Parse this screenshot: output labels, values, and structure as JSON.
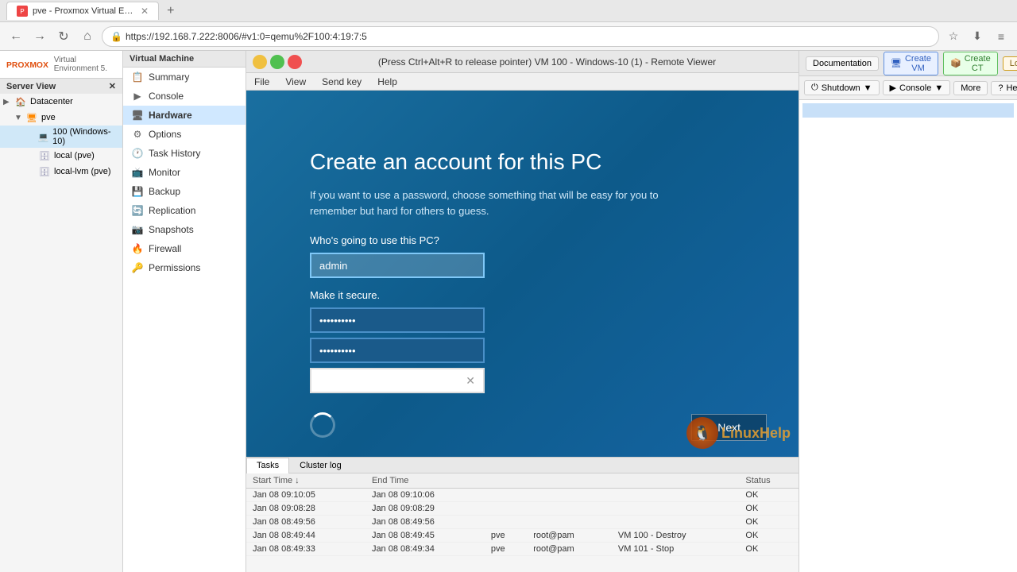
{
  "browser": {
    "tab_title": "pve - Proxmox Virtual Environ...",
    "url": "https://192.168.7.222:8006/#v1:0=qemu%2F100:4:19:7:5",
    "new_tab_label": "+"
  },
  "remote_viewer": {
    "title": "(Press Ctrl+Alt+R to release pointer) VM 100 - Windows-10 (1) - Remote Viewer",
    "menu_items": [
      "File",
      "View",
      "Send key",
      "Help"
    ]
  },
  "proxmox": {
    "logo_text": "PROXMOX",
    "subtitle": "Virtual Environment 5.",
    "server_view": "Server View",
    "tree": {
      "datacenter": "Datacenter",
      "server": "pve",
      "vm": "100 (Windows-10)",
      "storage1": "local (pve)",
      "storage2": "local-lvm (pve)"
    },
    "vm_menu": {
      "header": "Virtual Machine",
      "items": [
        {
          "id": "summary",
          "label": "Summary",
          "icon": "📋"
        },
        {
          "id": "console",
          "label": "Console",
          "icon": "▶"
        },
        {
          "id": "hardware",
          "label": "Hardware",
          "icon": "🖥"
        },
        {
          "id": "options",
          "label": "Options",
          "icon": "⚙"
        },
        {
          "id": "task-history",
          "label": "Task History",
          "icon": "🕐"
        },
        {
          "id": "monitor",
          "label": "Monitor",
          "icon": "📺"
        },
        {
          "id": "backup",
          "label": "Backup",
          "icon": "💾"
        },
        {
          "id": "replication",
          "label": "Replication",
          "icon": "🔄"
        },
        {
          "id": "snapshots",
          "label": "Snapshots",
          "icon": "📷"
        },
        {
          "id": "firewall",
          "label": "Firewall",
          "icon": "🔥"
        },
        {
          "id": "permissions",
          "label": "Permissions",
          "icon": "🔑"
        }
      ]
    },
    "header_buttons": {
      "documentation": "Documentation",
      "create_vm": "Create VM",
      "create_ct": "Create CT",
      "logout": "Logout"
    },
    "toolbar": {
      "shutdown": "Shutdown",
      "console": "Console",
      "more": "More",
      "help": "Help"
    }
  },
  "windows_setup": {
    "title": "Create an account for this PC",
    "description": "If you want to use a password, choose something that will be easy for you to remember but hard for others to guess.",
    "username_label": "Who's going to use this PC?",
    "username_value": "admin",
    "password_section_label": "Make it secure.",
    "password_dots": "••••••••••",
    "confirm_password_dots": "••••••••••",
    "hint_value": "",
    "next_button": "Next"
  },
  "tasks": {
    "tabs": [
      "Tasks",
      "Cluster log"
    ],
    "active_tab": "Tasks",
    "columns": [
      "Start Time",
      "End Time",
      "",
      "",
      "",
      "Status"
    ],
    "rows": [
      {
        "start": "Jan 08 09:10:05",
        "end": "Jan 08 09:10:06",
        "col3": "",
        "col4": "",
        "col5": "",
        "status": "OK"
      },
      {
        "start": "Jan 08 09:08:28",
        "end": "Jan 08 09:08:29",
        "col3": "",
        "col4": "",
        "col5": "",
        "status": "OK"
      },
      {
        "start": "Jan 08 08:49:56",
        "end": "Jan 08 08:49:56",
        "col3": "",
        "col4": "",
        "col5": "",
        "status": "OK"
      },
      {
        "start": "Jan 08 08:49:44",
        "end": "Jan 08 08:49:45",
        "col3": "pve",
        "col4": "root@pam",
        "col5": "VM 100 - Destroy",
        "status": "OK"
      },
      {
        "start": "Jan 08 08:49:33",
        "end": "Jan 08 08:49:34",
        "col3": "pve",
        "col4": "root@pam",
        "col5": "VM 101 - Stop",
        "status": "OK"
      }
    ]
  }
}
